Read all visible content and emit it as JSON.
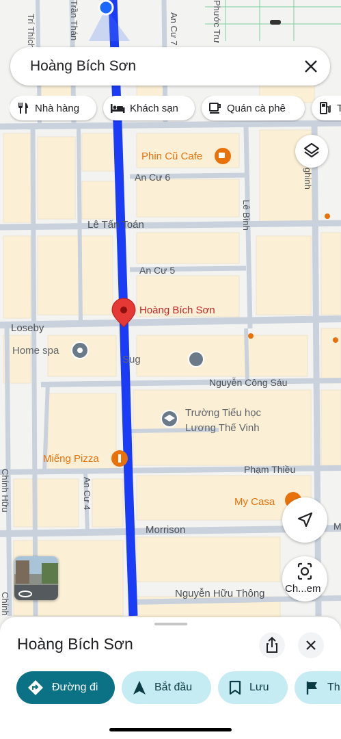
{
  "search": {
    "query": "Hoàng Bích Sơn"
  },
  "chips": [
    {
      "label": "Nhà hàng",
      "icon": "restaurant-icon"
    },
    {
      "label": "Khách sạn",
      "icon": "hotel-icon"
    },
    {
      "label": "Quán cà phê",
      "icon": "cafe-icon"
    },
    {
      "label": "T",
      "icon": "gas-station-icon"
    }
  ],
  "map": {
    "streets": {
      "an_cu_6": "An Cư 6",
      "le_tan_toan": "Lê Tấn Toán",
      "an_cu_5": "An Cư 5",
      "loseby": "Loseby",
      "nguyen_cong_sau": "Nguyễn Công Sáu",
      "pham_thieu": "Phạm Thiều",
      "morrison": "Morrison",
      "nguyen_huu_thong": "Nguyễn Hữu Thông",
      "le_binh": "Lê Bình",
      "an_cu_4": "An Cư 4",
      "an_cu_7": "An Cư 7",
      "tran_than": "Trần Thán",
      "tri_thich": "Trí Thích",
      "phuoc_tru": "Phước Trư",
      "chinh_huu": "Chính Hữu",
      "chinh_left": "Chính",
      "ghinh_edge": "ghinh",
      "m_edge": "M",
      "sugar_partial": "Sug"
    },
    "pois": {
      "phin_cu": "Phin Cũ Cafe",
      "pin": "Hoàng Bích Sơn",
      "home_spa": "Home spa",
      "school_line1": "Trường Tiểu học",
      "school_line2": "Lương Thế Vinh",
      "mieng_pizza": "Miếng Pizza",
      "my_casa": "My Casa"
    },
    "colors": {
      "route": "#1a3cf5",
      "land": "#f3f3f1",
      "road": "#c9d1dc",
      "building": "#fbf0d6",
      "poi_orange": "#e8710a",
      "pin": "#e53935"
    }
  },
  "controls": {
    "layers": "layers-icon",
    "location": "navigation-arrow-icon",
    "lens_label": "Ch...em"
  },
  "sheet": {
    "title": "Hoàng Bích Sơn",
    "share_icon": "share-icon",
    "close_icon": "close-icon",
    "actions": [
      {
        "label": "Đường đi",
        "icon": "directions-icon"
      },
      {
        "label": "Bắt đầu",
        "icon": "navigation-icon"
      },
      {
        "label": "Lưu",
        "icon": "bookmark-icon"
      },
      {
        "label": "Th",
        "icon": "flag-icon"
      }
    ],
    "action_colors": {
      "primary": "#0b7285",
      "secondary": "#c6ecf3"
    }
  }
}
